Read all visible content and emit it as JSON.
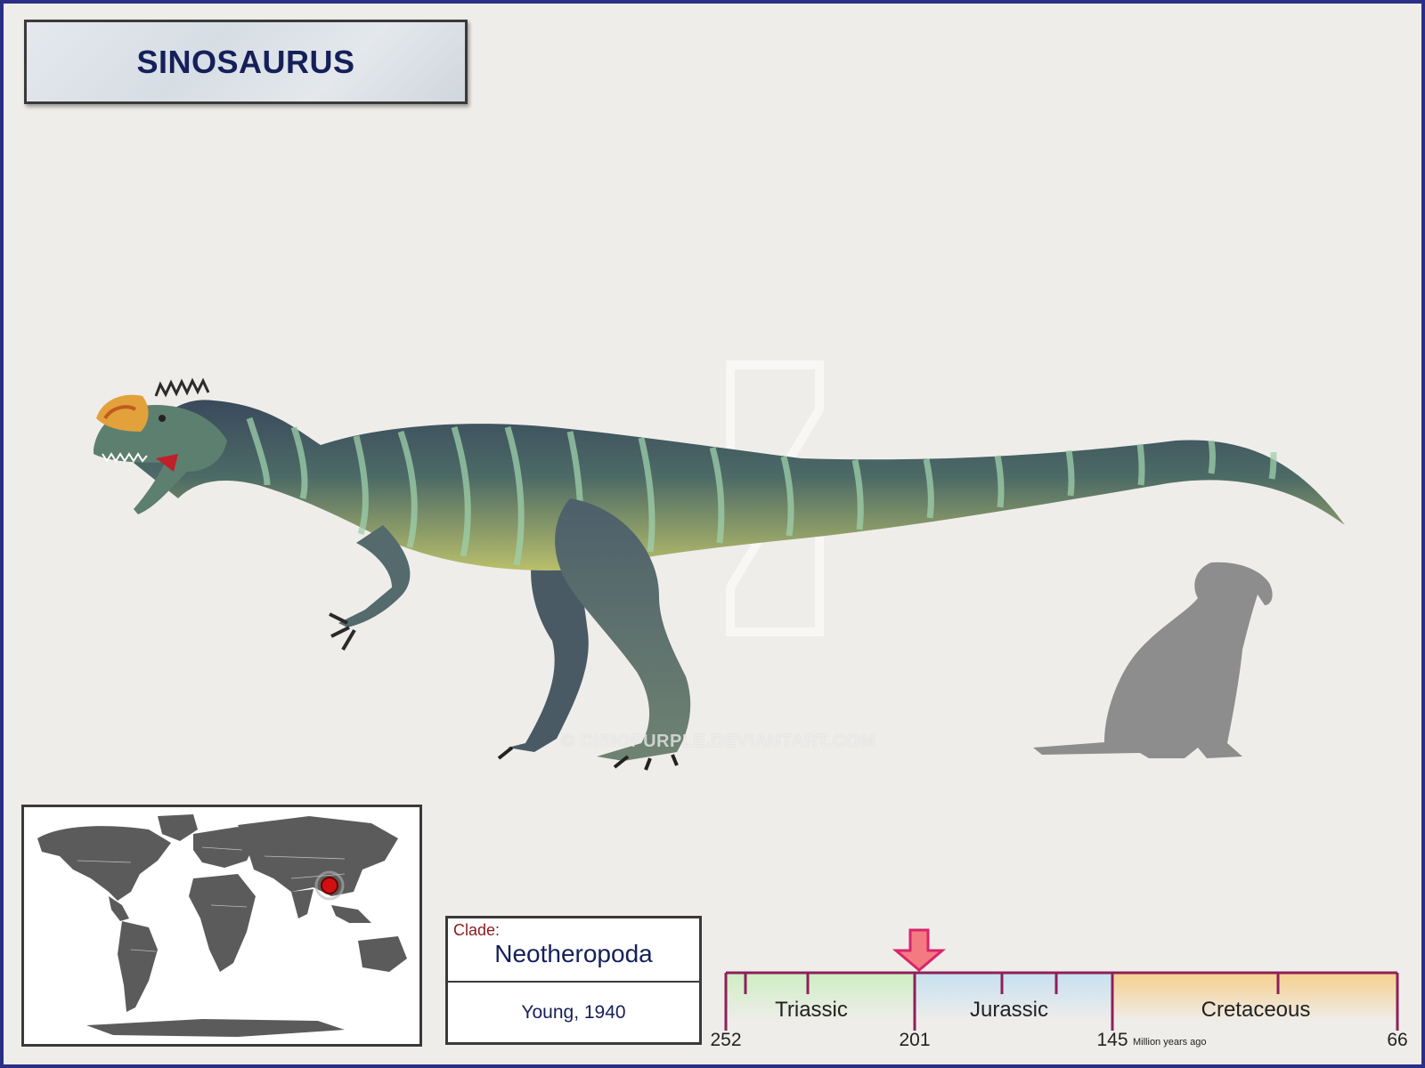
{
  "title": "SINOSAURUS",
  "watermark": "© CISIOPURPLE.DEVIANTART.COM",
  "clade": {
    "label": "Clade:",
    "value": "Neotheropoda",
    "author": "Young, 1940"
  },
  "timeline": {
    "periods": [
      "Triassic",
      "Jurassic",
      "Cretaceous"
    ],
    "ticks": [
      "252",
      "201",
      "145",
      "66"
    ],
    "unit": "Million years ago",
    "marker_ma": 201
  },
  "colors": {
    "frame": "#2c2f86",
    "title_text": "#15205a",
    "timeline_line": "#8e1f5a",
    "marker": "#f47a82",
    "triassic": "#cdeec2",
    "jurassic": "#c6e0f0",
    "cretaceous": "#f6cf8d",
    "map_land": "#5b5b5b",
    "locality": "#d01010"
  },
  "icons": [
    "world-map-icon",
    "locality-pin-icon",
    "down-arrow-icon",
    "dog-silhouette-icon"
  ]
}
